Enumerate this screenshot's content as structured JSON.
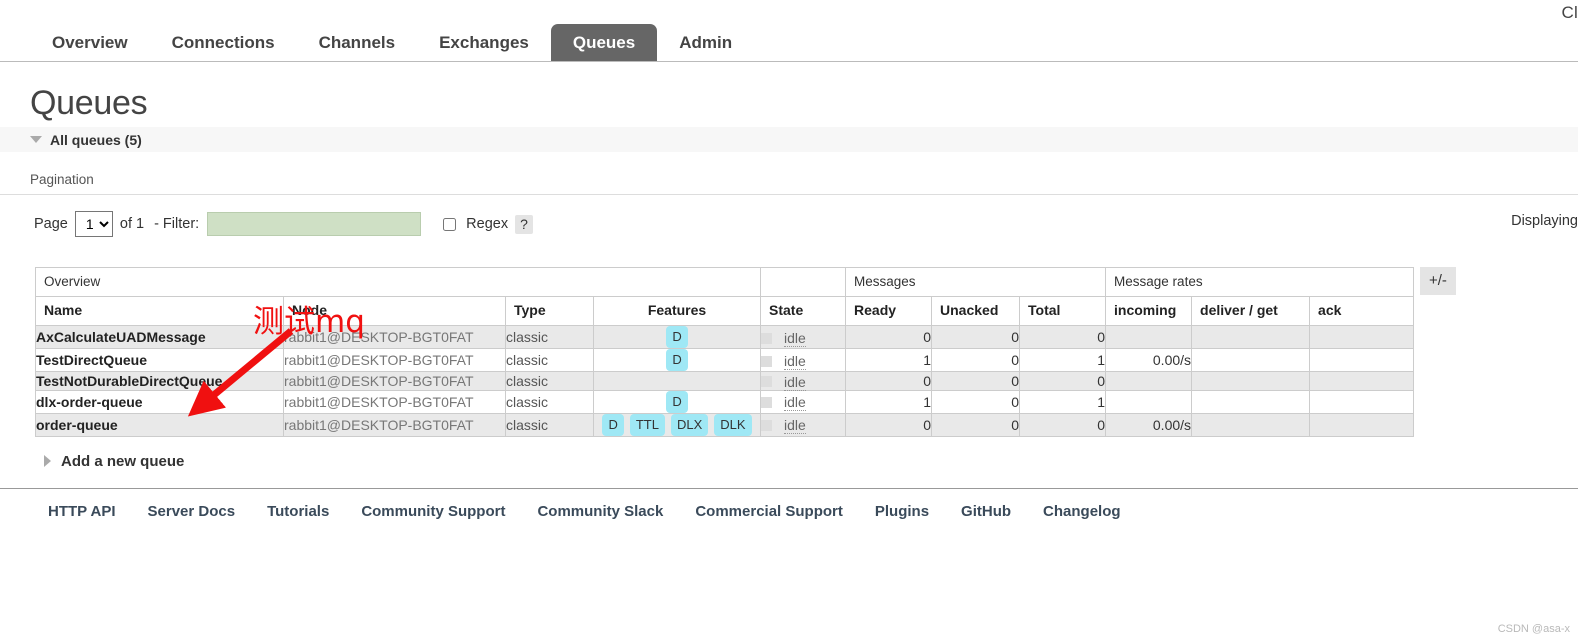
{
  "header": {
    "cluster_label": "Cl",
    "tabs": [
      {
        "label": "Overview",
        "active": false
      },
      {
        "label": "Connections",
        "active": false
      },
      {
        "label": "Channels",
        "active": false
      },
      {
        "label": "Exchanges",
        "active": false
      },
      {
        "label": "Queues",
        "active": true
      },
      {
        "label": "Admin",
        "active": false
      }
    ]
  },
  "page": {
    "title": "Queues",
    "section_label": "All queues (5)",
    "pagination_title": "Pagination"
  },
  "pagination": {
    "page_label": "Page",
    "page_value": "1",
    "page_options": [
      "1"
    ],
    "of_label": "of 1",
    "filter_label": "- Filter:",
    "filter_value": "",
    "filter_placeholder": "",
    "regex_label": "Regex",
    "regex_checked": false,
    "help_label": "?",
    "displaying_label": "Displaying"
  },
  "table": {
    "group_headers": [
      {
        "label": "Overview",
        "span": 4
      },
      {
        "label": "",
        "span": 1
      },
      {
        "label": "Messages",
        "span": 3
      },
      {
        "label": "Message rates",
        "span": 3
      }
    ],
    "columns": [
      "Name",
      "Node",
      "Type",
      "Features",
      "State",
      "Ready",
      "Unacked",
      "Total",
      "incoming",
      "deliver / get",
      "ack"
    ],
    "plusminus_label": "+/-",
    "rows": [
      {
        "name": "AxCalculateUADMessage",
        "node": "rabbit1@DESKTOP-BGT0FAT",
        "type": "classic",
        "features": [
          "D"
        ],
        "state": "idle",
        "ready": "0",
        "unacked": "0",
        "total": "0",
        "incoming": "",
        "deliver_get": "",
        "ack": ""
      },
      {
        "name": "TestDirectQueue",
        "node": "rabbit1@DESKTOP-BGT0FAT",
        "type": "classic",
        "features": [
          "D"
        ],
        "state": "idle",
        "ready": "1",
        "unacked": "0",
        "total": "1",
        "incoming": "0.00/s",
        "deliver_get": "",
        "ack": ""
      },
      {
        "name": "TestNotDurableDirectQueue",
        "node": "rabbit1@DESKTOP-BGT0FAT",
        "type": "classic",
        "features": [],
        "state": "idle",
        "ready": "0",
        "unacked": "0",
        "total": "0",
        "incoming": "",
        "deliver_get": "",
        "ack": ""
      },
      {
        "name": "dlx-order-queue",
        "node": "rabbit1@DESKTOP-BGT0FAT",
        "type": "classic",
        "features": [
          "D"
        ],
        "state": "idle",
        "ready": "1",
        "unacked": "0",
        "total": "1",
        "incoming": "",
        "deliver_get": "",
        "ack": ""
      },
      {
        "name": "order-queue",
        "node": "rabbit1@DESKTOP-BGT0FAT",
        "type": "classic",
        "features": [
          "D",
          "TTL",
          "DLX",
          "DLK"
        ],
        "state": "idle",
        "ready": "0",
        "unacked": "0",
        "total": "0",
        "incoming": "0.00/s",
        "deliver_get": "",
        "ack": ""
      }
    ]
  },
  "add_queue": {
    "label": "Add a new queue"
  },
  "footer": {
    "links": [
      "HTTP API",
      "Server Docs",
      "Tutorials",
      "Community Support",
      "Community Slack",
      "Commercial Support",
      "Plugins",
      "GitHub",
      "Changelog"
    ]
  },
  "annotation": {
    "text": "测试mq",
    "color": "#f01010"
  },
  "watermark": {
    "text": "CSDN @asa-x"
  },
  "colors": {
    "active_tab_bg": "#666666",
    "badge_bg": "#9fe8f5",
    "filter_bg": "#cfe0c5",
    "row_alt_bg": "#e9e9e9"
  }
}
